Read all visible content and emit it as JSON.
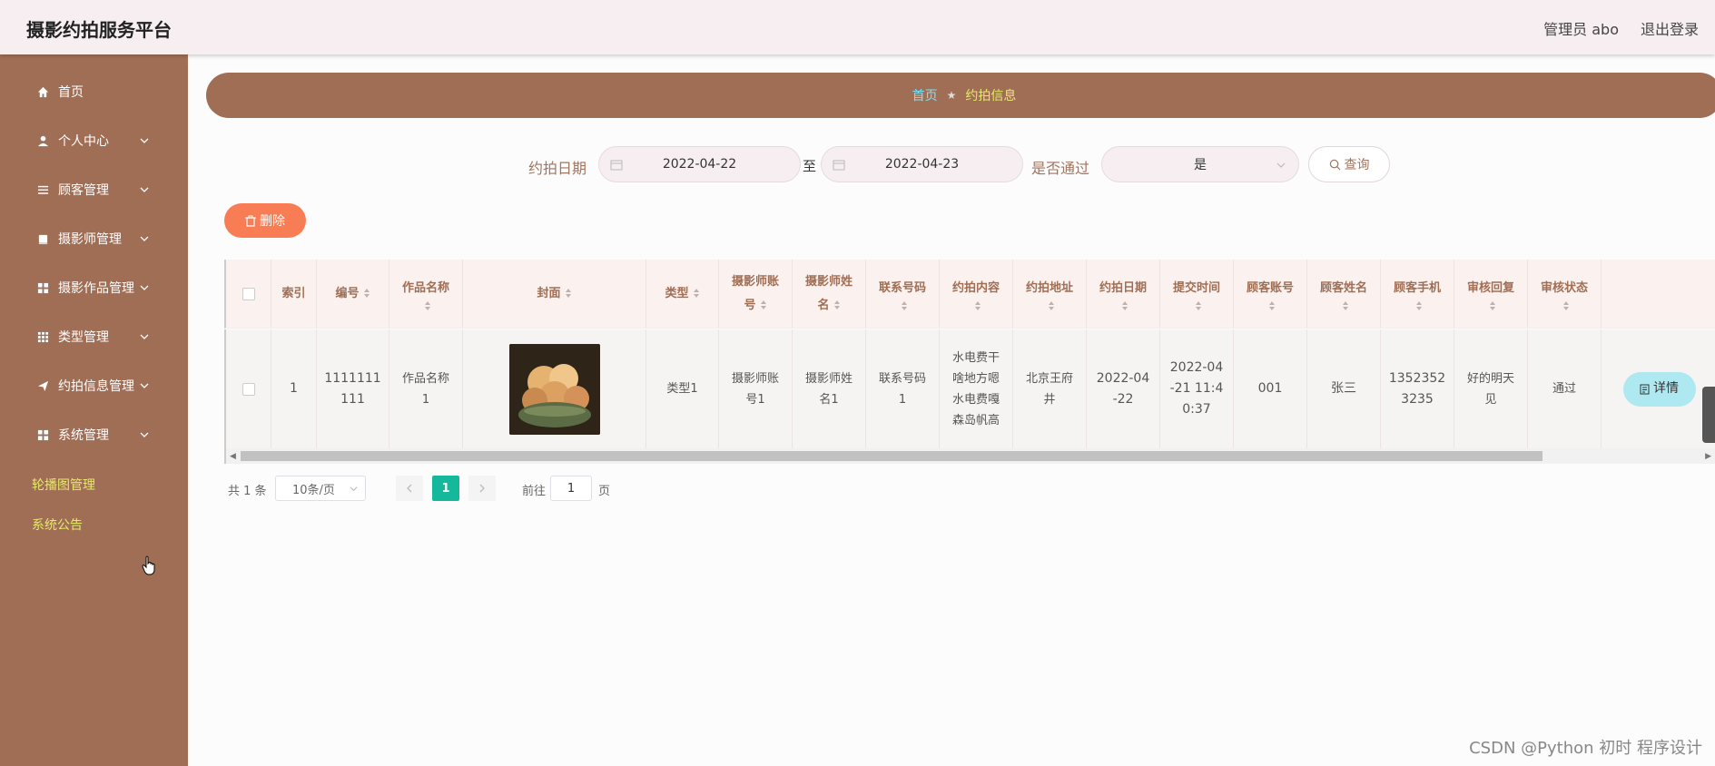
{
  "header": {
    "title": "摄影约拍服务平台",
    "user": "管理员 abo",
    "logout": "退出登录"
  },
  "sidebar": {
    "items": [
      {
        "label": "首页",
        "icon": "home-icon"
      },
      {
        "label": "个人中心",
        "icon": "user-icon"
      },
      {
        "label": "顾客管理",
        "icon": "list-icon"
      },
      {
        "label": "摄影师管理",
        "icon": "book-icon"
      },
      {
        "label": "摄影作品管理",
        "icon": "grid-icon"
      },
      {
        "label": "类型管理",
        "icon": "apps-icon"
      },
      {
        "label": "约拍信息管理",
        "icon": "send-icon"
      },
      {
        "label": "系统管理",
        "icon": "grid-icon"
      }
    ],
    "sublinks": [
      "轮播图管理",
      "系统公告"
    ]
  },
  "breadcrumb": {
    "home": "首页",
    "sep": "★",
    "current": "约拍信息"
  },
  "filters": {
    "date_label": "约拍日期",
    "date_from": "2022-04-22",
    "to_label": "至",
    "date_to": "2022-04-23",
    "pass_label": "是否通过",
    "pass_value": "是",
    "query_label": "查询"
  },
  "delete_label": "删除",
  "table": {
    "headers": [
      "索引",
      "编号",
      "作品名称",
      "封面",
      "类型",
      "摄影师账号",
      "摄影师姓名",
      "联系号码",
      "约拍内容",
      "约拍地址",
      "约拍日期",
      "提交时间",
      "顾客账号",
      "顾客姓名",
      "顾客手机",
      "审核回复",
      "审核状态"
    ],
    "header_lines": {
      "works": [
        "作品名称"
      ],
      "acct": [
        "摄影师账",
        "号"
      ],
      "name": [
        "摄影师姓",
        "名"
      ]
    },
    "row": {
      "index": "1",
      "code_l1": "1111111",
      "code_l2": "111",
      "works_l1": "作品名称",
      "works_l2": "1",
      "type": "类型1",
      "acct_l1": "摄影师账",
      "acct_l2": "号1",
      "name_l1": "摄影师姓",
      "name_l2": "名1",
      "phone_l1": "联系号码",
      "phone_l2": "1",
      "content_l1": "水电费干",
      "content_l2": "啥地方嗯",
      "content_l3": "水电费嘎",
      "content_l4": "森岛帆高",
      "addr_l1": "北京王府",
      "addr_l2": "井",
      "date_l1": "2022-04",
      "date_l2": "-22",
      "submit_l1": "2022-04",
      "submit_l2": "-21 11:4",
      "submit_l3": "0:37",
      "cust_acct": "001",
      "cust_name": "张三",
      "cust_phone_l1": "1352352",
      "cust_phone_l2": "3235",
      "reply_l1": "好的明天",
      "reply_l2": "见",
      "status": "通过",
      "detail_label": "详情"
    }
  },
  "pager": {
    "total": "共 1 条",
    "size": "10条/页",
    "page": "1",
    "goto_label": "前往",
    "goto_value": "1",
    "page_suffix": "页"
  },
  "watermark": "CSDN @Python 初时 程序设计",
  "colors": {
    "sidebar": "#a06e55",
    "accent_green": "#14b89a",
    "delete": "#f97d54",
    "detail": "#aee8f0"
  }
}
